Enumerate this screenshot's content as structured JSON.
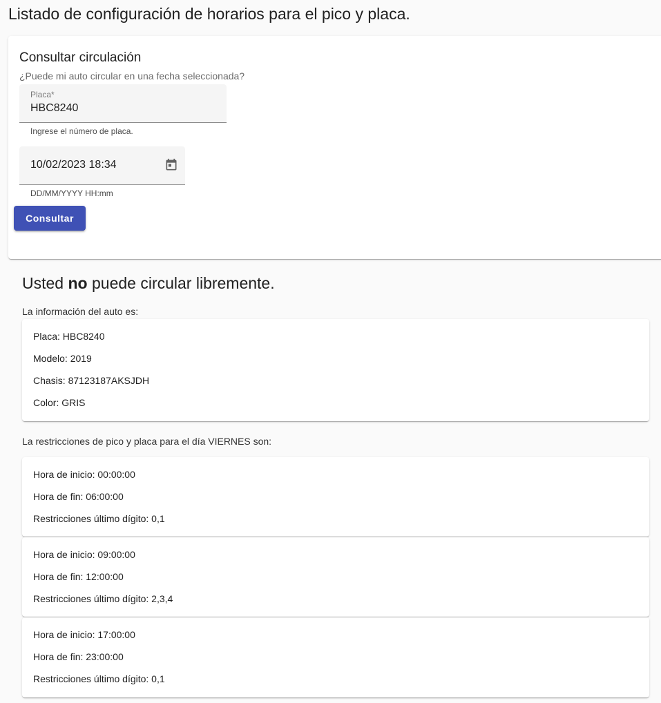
{
  "page_title": "Listado de configuración de horarios para el pico y placa.",
  "query": {
    "title": "Consultar circulación",
    "subtitle": "¿Puede mi auto circular en una fecha seleccionada?",
    "plate_field": {
      "label": "Placa*",
      "value": "HBC8240",
      "hint": "Ingrese el número de placa."
    },
    "date_field": {
      "value": "10/02/2023 18:34",
      "hint": "DD/MM/YYYY HH:mm",
      "icon": "calendar-icon"
    },
    "submit_label": "Consultar",
    "accent_color": "#3f51b5"
  },
  "result": {
    "prefix": "Usted ",
    "emphasis": "no",
    "suffix": " puede circular libremente.",
    "car_section_label": "La información del auto es:",
    "car": {
      "plate": "Placa: HBC8240",
      "model": "Modelo: 2019",
      "chassis": "Chasis: 87123187AKSJDH",
      "color": "Color: GRIS"
    },
    "restrictions_label": "La restricciones de pico y placa para el día VIERNES son:",
    "restrictions": [
      {
        "start": "Hora de inicio: 00:00:00",
        "end": "Hora de fin: 06:00:00",
        "digits": "Restricciones último dígito: 0,1"
      },
      {
        "start": "Hora de inicio: 09:00:00",
        "end": "Hora de fin: 12:00:00",
        "digits": "Restricciones último dígito: 2,3,4"
      },
      {
        "start": "Hora de inicio: 17:00:00",
        "end": "Hora de fin: 23:00:00",
        "digits": "Restricciones último dígito: 0,1"
      }
    ]
  }
}
